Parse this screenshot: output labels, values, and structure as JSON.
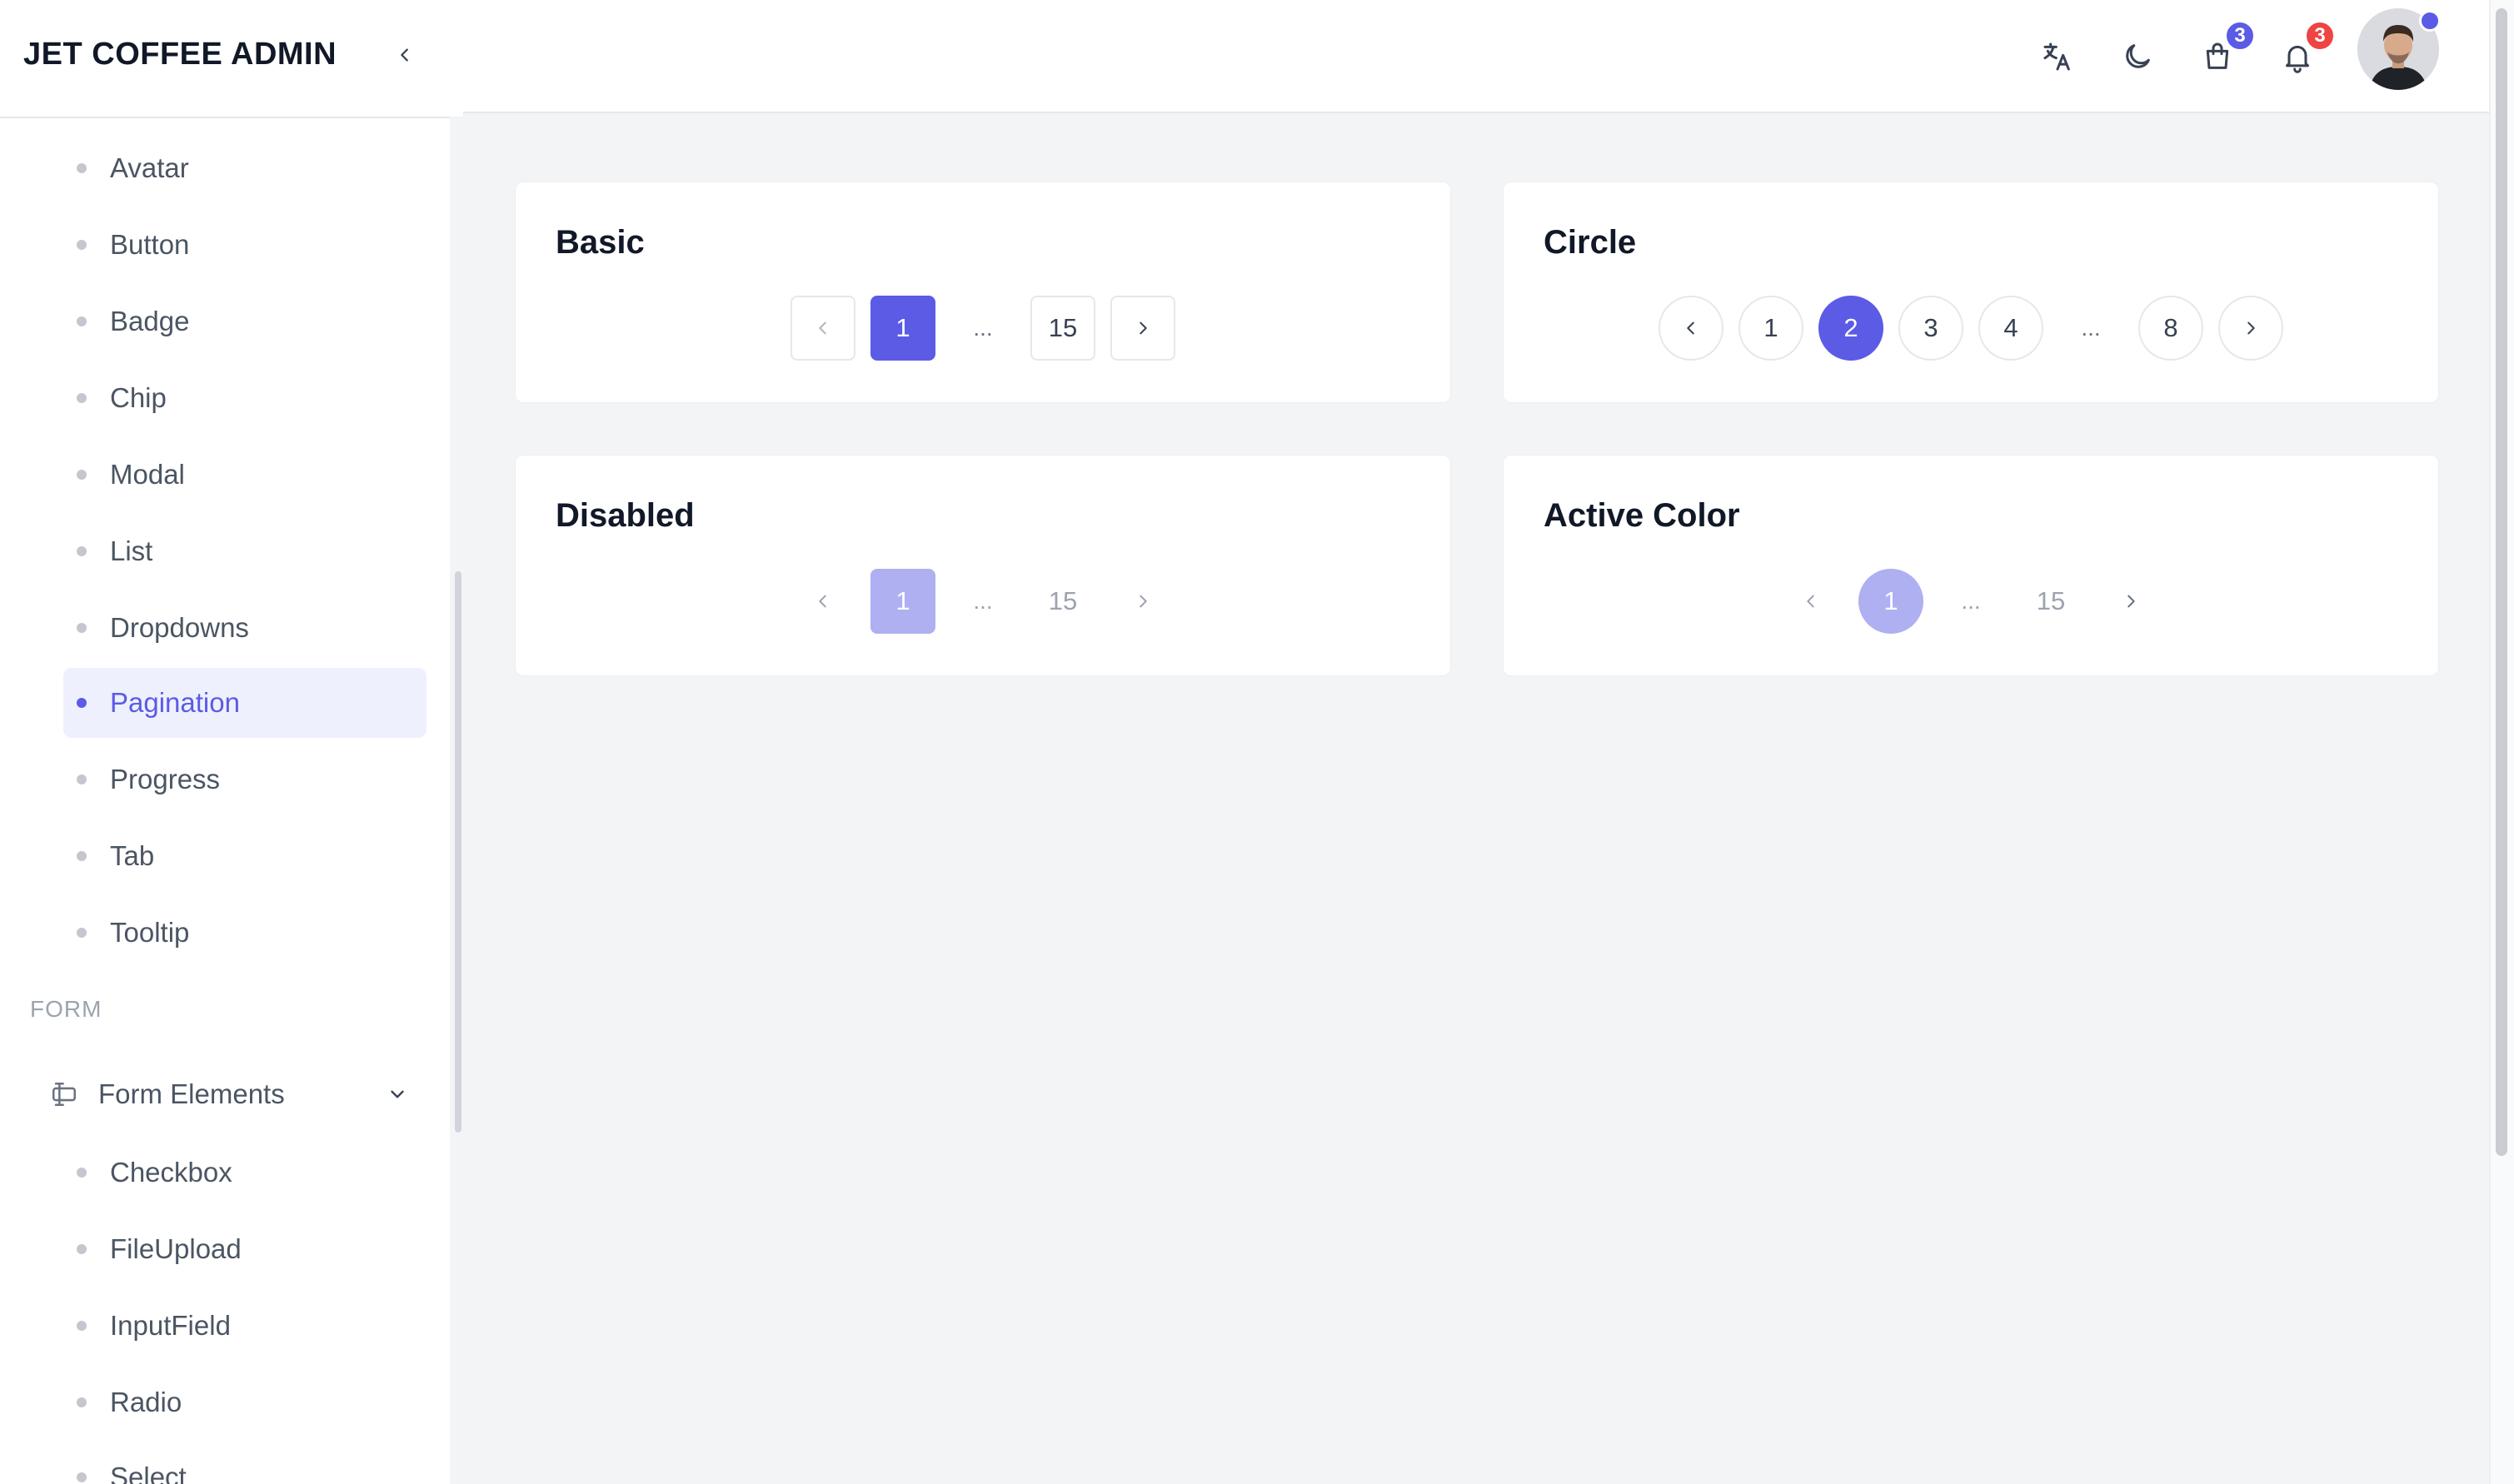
{
  "app": {
    "brand": "JET COFFEE ADMIN"
  },
  "sidebar": {
    "items": [
      {
        "label": "Avatar"
      },
      {
        "label": "Button"
      },
      {
        "label": "Badge"
      },
      {
        "label": "Chip"
      },
      {
        "label": "Modal"
      },
      {
        "label": "List"
      },
      {
        "label": "Dropdowns"
      },
      {
        "label": "Pagination",
        "active": true
      },
      {
        "label": "Progress"
      },
      {
        "label": "Tab"
      },
      {
        "label": "Tooltip"
      }
    ],
    "section_form": "FORM",
    "group_form_elements": "Form Elements",
    "form_items": [
      {
        "label": "Checkbox"
      },
      {
        "label": "FileUpload"
      },
      {
        "label": "InputField"
      },
      {
        "label": "Radio"
      },
      {
        "label": "Select"
      }
    ]
  },
  "topbar": {
    "icons": [
      "translate-icon",
      "moon-icon",
      "shopping-bag-icon",
      "bell-icon"
    ],
    "cart_badge": "3",
    "notifications_badge": "3"
  },
  "colors": {
    "accent": "#5b5be6",
    "accent_soft": "#aeb0f2",
    "badge_red": "#ef4444"
  },
  "cards": {
    "basic": {
      "title": "Basic",
      "first": "1",
      "ellipsis": "...",
      "last": "15"
    },
    "circle": {
      "title": "Circle",
      "pages": [
        "1",
        "2",
        "3",
        "4"
      ],
      "ellipsis": "...",
      "last": "8",
      "active": "2"
    },
    "disabled": {
      "title": "Disabled",
      "first": "1",
      "ellipsis": "...",
      "last": "15"
    },
    "active_color": {
      "title": "Active Color",
      "first": "1",
      "ellipsis": "...",
      "last": "15"
    }
  }
}
